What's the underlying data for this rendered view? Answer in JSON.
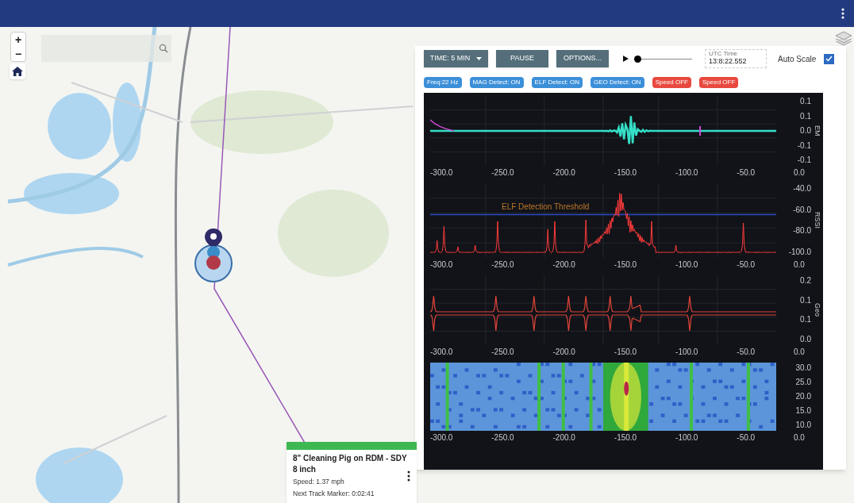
{
  "map": {
    "zoom_controls": [
      "+",
      "−"
    ]
  },
  "toolbar": {
    "time_button": "TIME: 5 MIN",
    "pause_button": "PAUSE",
    "options_button": "OPTIONS...",
    "playback": {
      "level": 0.02
    },
    "utc_label": "UTC Time",
    "utc_value": "13:8:22.552",
    "auto_scale": {
      "label": "Auto Scale",
      "checked": true
    }
  },
  "badges": [
    {
      "text": "Freq:22 Hz",
      "color": "#3b8fd9"
    },
    {
      "text": "MAG Detect: ON",
      "color": "#3b8fd9"
    },
    {
      "text": "ELF Detect: ON",
      "color": "#3b8fd9"
    },
    {
      "text": "GEO Detect: ON",
      "color": "#3b8fd9"
    },
    {
      "text": "Speed OFF",
      "color": "#e8493f"
    },
    {
      "text": "Speed OFF",
      "color": "#e8493f"
    }
  ],
  "charts": [
    {
      "kind": "em",
      "axis_title": "EM",
      "y_labels": [
        "0.1",
        "0.1",
        "0.0",
        "-0.1",
        "-0.1"
      ],
      "x_labels": [
        "-300.0",
        "-250.0",
        "-200.0",
        "-150.0",
        "-100.0",
        "-50.0",
        "0.0"
      ]
    },
    {
      "kind": "rssi",
      "axis_title": "RSSI",
      "threshold_label": "ELF Detection Threshold",
      "y_labels": [
        "-40.0",
        "-60.0",
        "-80.0",
        "-100.0"
      ],
      "x_labels": [
        "-300.0",
        "-250.0",
        "-200.0",
        "-150.0",
        "-100.0",
        "-50.0",
        "0.0"
      ]
    },
    {
      "kind": "geo",
      "axis_title": "Geo",
      "y_labels": [
        "0.2",
        "0.1",
        "0.1",
        "0.0"
      ],
      "x_labels": [
        "-300.0",
        "-250.0",
        "-200.0",
        "-150.0",
        "-100.0",
        "-50.0",
        "0.0"
      ]
    },
    {
      "kind": "spectrogram",
      "y_labels": [
        "30.0",
        "25.0",
        "20.0",
        "15.0",
        "10.0"
      ],
      "x_labels": [
        "-300.0",
        "-250.0",
        "-200.0",
        "-150.0",
        "-100.0",
        "-50.0",
        "0.0"
      ]
    }
  ],
  "popup": {
    "title": "8\" Cleaning Pig on RDM - SDY 8 inch",
    "lines": [
      "Speed: 1.37 mph",
      "Next Track Marker: 0:02:41"
    ]
  }
}
